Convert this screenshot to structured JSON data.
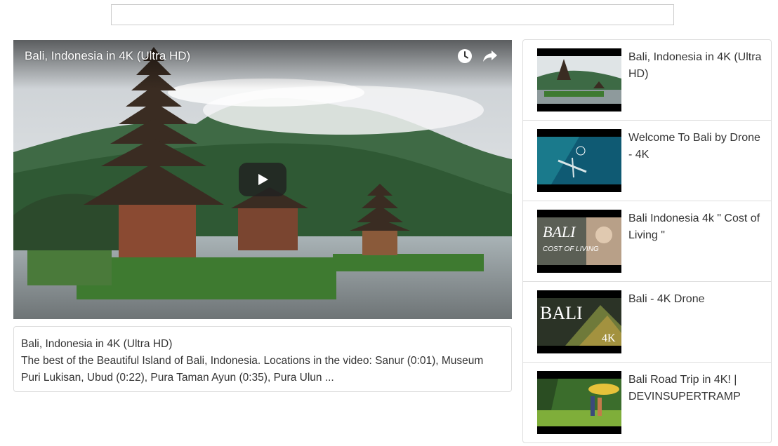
{
  "search": {
    "value": "",
    "placeholder": ""
  },
  "player": {
    "title": "Bali, Indonesia in 4K (Ultra HD)",
    "icons": [
      "clock-icon",
      "share-icon",
      "play-icon"
    ]
  },
  "description": {
    "title": "Bali, Indonesia in 4K (Ultra HD)",
    "text": "The best of the Beautiful Island of Bali, Indonesia. Locations in the video: Sanur (0:01), Museum Puri Lukisan, Ubud (0:22), Pura Taman Ayun (0:35), Pura Ulun ..."
  },
  "playlist": [
    {
      "title": "Bali, Indonesia in 4K (Ultra HD)"
    },
    {
      "title": "Welcome To Bali by Drone - 4K"
    },
    {
      "title": "Bali Indonesia 4k \" Cost of Living \"",
      "thumb_text": [
        "BALI",
        "COST OF LIVING"
      ]
    },
    {
      "title": "Bali - 4K Drone",
      "thumb_text": [
        "BALI",
        "4K"
      ]
    },
    {
      "title": "Bali Road Trip in 4K! | DEVINSUPERTRAMP"
    }
  ]
}
